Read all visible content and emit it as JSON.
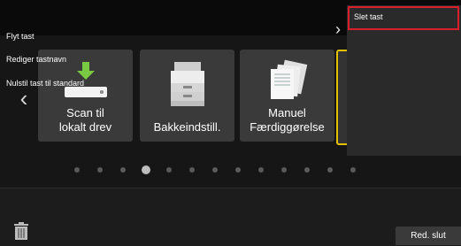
{
  "tiles": [
    {
      "label_line1": "Scan til",
      "label_line2": "lokalt drev"
    },
    {
      "label": "Bakkeindstill."
    },
    {
      "label_line1": "Manuel",
      "label_line2": "Færdiggørelse"
    }
  ],
  "pagination": {
    "pages": 13,
    "active_index": 3
  },
  "menu": {
    "items": [
      "Slet tast",
      "Flyt tast",
      "Rediger tastnavn",
      "Nulstil tast til standard"
    ]
  },
  "footer": {
    "end_edit_label": "Red. slut"
  },
  "colors": {
    "accent_selected": "#d8202c",
    "tile_highlight": "#e6c100",
    "download_arrow": "#7ac943"
  }
}
